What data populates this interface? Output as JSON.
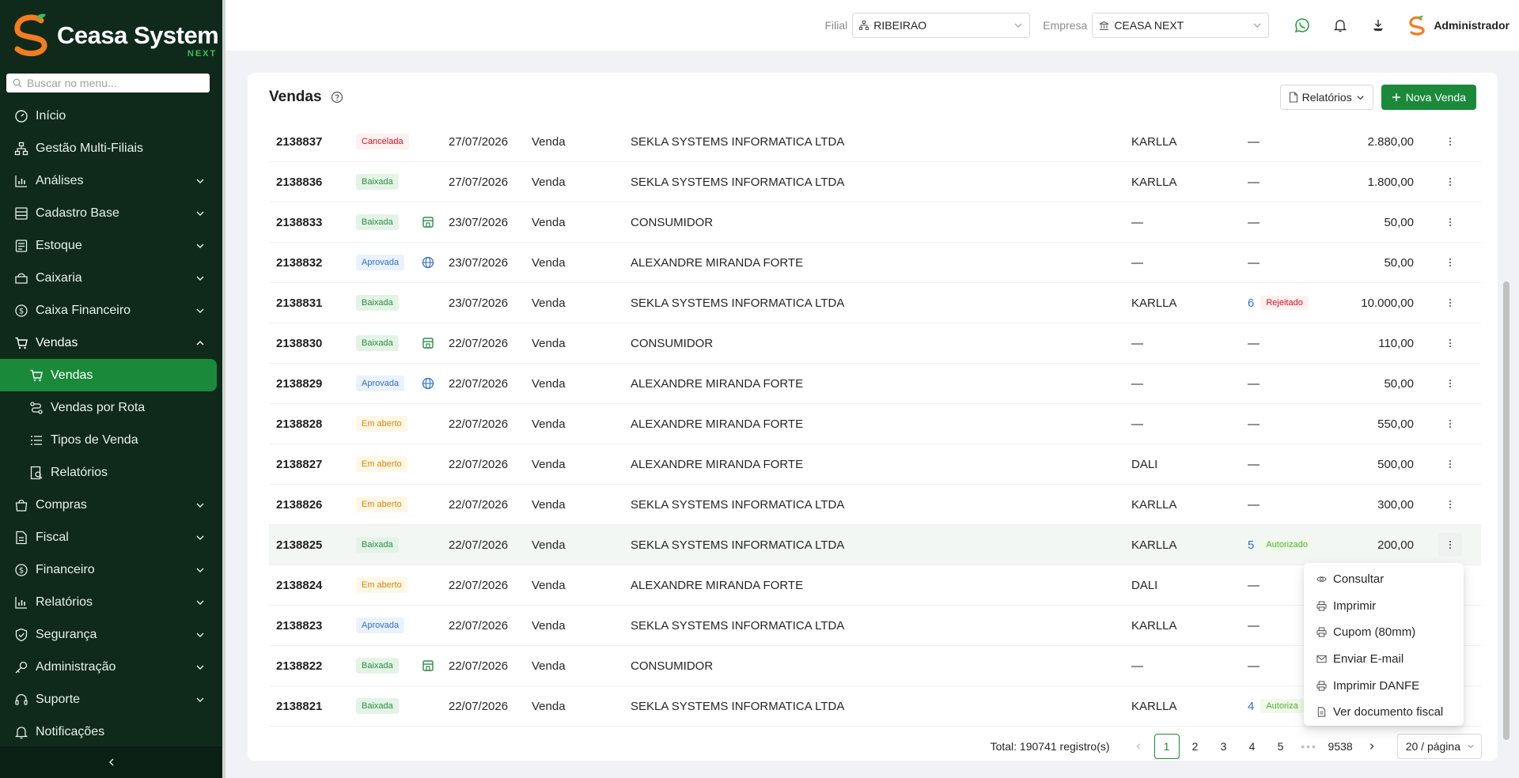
{
  "brand": {
    "name": "Ceasa System",
    "sub": "NEXT",
    "accent": "#1a8a3a",
    "orange": "#f57c1f"
  },
  "search": {
    "placeholder": "Buscar no menu..."
  },
  "menu": {
    "inicio": "Início",
    "multi": "Gestão Multi-Filiais",
    "analises": "Análises",
    "cadastro": "Cadastro Base",
    "estoque": "Estoque",
    "caixaria": "Caixaria",
    "caixa_fin": "Caixa Financeiro",
    "vendas": "Vendas",
    "vendas_sub": "Vendas",
    "vendas_rota": "Vendas por Rota",
    "tipos_venda": "Tipos de Venda",
    "relatorios_sub": "Relatórios",
    "compras": "Compras",
    "fiscal": "Fiscal",
    "financeiro": "Financeiro",
    "relatorios": "Relatórios",
    "seguranca": "Segurança",
    "administracao": "Administração",
    "suporte": "Suporte",
    "notificacoes": "Notificações"
  },
  "topbar": {
    "filial_label": "Filial",
    "filial_value": "RIBEIRAO",
    "empresa_label": "Empresa",
    "empresa_value": "CEASA NEXT",
    "user": "Administrador"
  },
  "page": {
    "title": "Vendas",
    "reports_btn": "Relatórios",
    "new_btn": "Nova Venda"
  },
  "rows": [
    {
      "id": "2138837",
      "status": "Cancelada",
      "status_kind": "cancelada",
      "channel": "",
      "date": "27/07/2026",
      "type": "Venda",
      "client": "SEKLA SYSTEMS INFORMATICA LTDA",
      "seller": "KARLLA",
      "nf_num": "",
      "nf_status": "",
      "nf_kind": "",
      "nf_dash": "—",
      "total": "2.880,00"
    },
    {
      "id": "2138836",
      "status": "Baixada",
      "status_kind": "baixada",
      "channel": "",
      "date": "27/07/2026",
      "type": "Venda",
      "client": "SEKLA SYSTEMS INFORMATICA LTDA",
      "seller": "KARLLA",
      "nf_num": "",
      "nf_status": "",
      "nf_kind": "",
      "nf_dash": "—",
      "total": "1.800,00"
    },
    {
      "id": "2138833",
      "status": "Baixada",
      "status_kind": "baixada",
      "channel": "store",
      "date": "23/07/2026",
      "type": "Venda",
      "client": "CONSUMIDOR",
      "seller": "—",
      "nf_num": "",
      "nf_status": "",
      "nf_kind": "",
      "nf_dash": "—",
      "total": "50,00"
    },
    {
      "id": "2138832",
      "status": "Aprovada",
      "status_kind": "aprovada",
      "channel": "web",
      "date": "23/07/2026",
      "type": "Venda",
      "client": "ALEXANDRE MIRANDA FORTE",
      "seller": "—",
      "nf_num": "",
      "nf_status": "",
      "nf_kind": "",
      "nf_dash": "—",
      "total": "50,00"
    },
    {
      "id": "2138831",
      "status": "Baixada",
      "status_kind": "baixada",
      "channel": "",
      "date": "23/07/2026",
      "type": "Venda",
      "client": "SEKLA SYSTEMS INFORMATICA LTDA",
      "seller": "KARLLA",
      "nf_num": "6",
      "nf_status": "Rejeitado",
      "nf_kind": "rejeitado",
      "nf_dash": "",
      "total": "10.000,00"
    },
    {
      "id": "2138830",
      "status": "Baixada",
      "status_kind": "baixada",
      "channel": "store",
      "date": "22/07/2026",
      "type": "Venda",
      "client": "CONSUMIDOR",
      "seller": "—",
      "nf_num": "",
      "nf_status": "",
      "nf_kind": "",
      "nf_dash": "—",
      "total": "110,00"
    },
    {
      "id": "2138829",
      "status": "Aprovada",
      "status_kind": "aprovada",
      "channel": "web",
      "date": "22/07/2026",
      "type": "Venda",
      "client": "ALEXANDRE MIRANDA FORTE",
      "seller": "—",
      "nf_num": "",
      "nf_status": "",
      "nf_kind": "",
      "nf_dash": "—",
      "total": "50,00"
    },
    {
      "id": "2138828",
      "status": "Em aberto",
      "status_kind": "aberto",
      "channel": "",
      "date": "22/07/2026",
      "type": "Venda",
      "client": "ALEXANDRE MIRANDA FORTE",
      "seller": "—",
      "nf_num": "",
      "nf_status": "",
      "nf_kind": "",
      "nf_dash": "—",
      "total": "550,00"
    },
    {
      "id": "2138827",
      "status": "Em aberto",
      "status_kind": "aberto",
      "channel": "",
      "date": "22/07/2026",
      "type": "Venda",
      "client": "ALEXANDRE MIRANDA FORTE",
      "seller": "DALI",
      "nf_num": "",
      "nf_status": "",
      "nf_kind": "",
      "nf_dash": "—",
      "total": "500,00"
    },
    {
      "id": "2138826",
      "status": "Em aberto",
      "status_kind": "aberto",
      "channel": "",
      "date": "22/07/2026",
      "type": "Venda",
      "client": "SEKLA SYSTEMS INFORMATICA LTDA",
      "seller": "KARLLA",
      "nf_num": "",
      "nf_status": "",
      "nf_kind": "",
      "nf_dash": "—",
      "total": "300,00"
    },
    {
      "id": "2138825",
      "status": "Baixada",
      "status_kind": "baixada",
      "channel": "",
      "date": "22/07/2026",
      "type": "Venda",
      "client": "SEKLA SYSTEMS INFORMATICA LTDA",
      "seller": "KARLLA",
      "nf_num": "5",
      "nf_status": "Autorizado",
      "nf_kind": "autorizado",
      "nf_dash": "",
      "total": "200,00"
    },
    {
      "id": "2138824",
      "status": "Em aberto",
      "status_kind": "aberto",
      "channel": "",
      "date": "22/07/2026",
      "type": "Venda",
      "client": "ALEXANDRE MIRANDA FORTE",
      "seller": "DALI",
      "nf_num": "",
      "nf_status": "",
      "nf_kind": "",
      "nf_dash": "—",
      "total": ""
    },
    {
      "id": "2138823",
      "status": "Aprovada",
      "status_kind": "aprovada",
      "channel": "",
      "date": "22/07/2026",
      "type": "Venda",
      "client": "SEKLA SYSTEMS INFORMATICA LTDA",
      "seller": "KARLLA",
      "nf_num": "",
      "nf_status": "",
      "nf_kind": "",
      "nf_dash": "—",
      "total": ""
    },
    {
      "id": "2138822",
      "status": "Baixada",
      "status_kind": "baixada",
      "channel": "store",
      "date": "22/07/2026",
      "type": "Venda",
      "client": "CONSUMIDOR",
      "seller": "—",
      "nf_num": "",
      "nf_status": "",
      "nf_kind": "",
      "nf_dash": "—",
      "total": ""
    },
    {
      "id": "2138821",
      "status": "Baixada",
      "status_kind": "baixada",
      "channel": "",
      "date": "22/07/2026",
      "type": "Venda",
      "client": "SEKLA SYSTEMS INFORMATICA LTDA",
      "seller": "KARLLA",
      "nf_num": "4",
      "nf_status": "Autoriza",
      "nf_kind": "autorizado",
      "nf_dash": "",
      "total": ""
    }
  ],
  "dropdown": [
    {
      "label": "Consultar",
      "icon": "eye-icon"
    },
    {
      "label": "Imprimir",
      "icon": "printer-icon"
    },
    {
      "label": "Cupom (80mm)",
      "icon": "printer-icon"
    },
    {
      "label": "Enviar E-mail",
      "icon": "mail-icon"
    },
    {
      "label": "Imprimir DANFE",
      "icon": "printer-icon"
    },
    {
      "label": "Ver documento fiscal",
      "icon": "document-icon"
    }
  ],
  "pagination": {
    "total": "Total: 190741 registro(s)",
    "pages": [
      "1",
      "2",
      "3",
      "4",
      "5"
    ],
    "ellipsis": "•••",
    "last": "9538",
    "page_size": "20 / página"
  }
}
